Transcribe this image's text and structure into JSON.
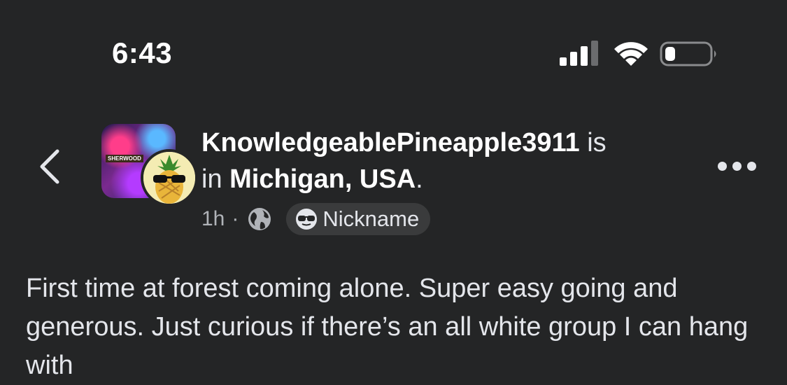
{
  "status_bar": {
    "time": "6:43",
    "signal_icon": "cellular-signal-icon",
    "wifi_icon": "wifi-icon",
    "battery_icon": "battery-low-icon"
  },
  "post": {
    "author": "KnowledgeablePineapple3911",
    "is_text": " is",
    "in_text": "in ",
    "location": "Michigan, USA",
    "period": ".",
    "time_ago": "1h",
    "separator": "·",
    "privacy_icon": "globe-icon",
    "badge_label": "Nickname",
    "body": "First time at forest coming alone. Super easy going and generous. Just curious if there’s an all white group I can hang with"
  },
  "avatar": {
    "group_sign_text": "SHERWOOD"
  },
  "colors": {
    "background": "#242526",
    "text": "#e4e6eb",
    "muted": "#b0b3b8",
    "chip": "#3a3b3c"
  }
}
